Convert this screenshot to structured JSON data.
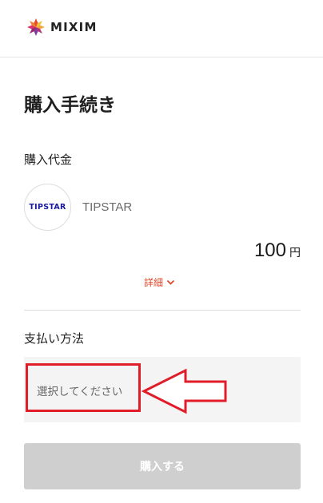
{
  "brand": {
    "name": "MIXIM",
    "logo_icon": "mixim-logo-icon",
    "logo_colors": [
      "#e84a2b",
      "#f2a93b",
      "#7b3fa0",
      "#d6336c"
    ]
  },
  "page": {
    "title": "購入手続き"
  },
  "purchase_amount": {
    "label": "購入代金",
    "product": {
      "logo_text": "TIPSTAR",
      "name": "TIPSTAR"
    },
    "price": "100",
    "currency": "円",
    "details_link": "詳細",
    "details_icon": "chevron-down-icon"
  },
  "payment": {
    "label": "支払い方法",
    "select_placeholder": "選択してください"
  },
  "annotation": {
    "highlight_color": "#e11d2a",
    "arrow_icon": "left-arrow-icon"
  },
  "actions": {
    "purchase_label": "購入する",
    "purchase_disabled": true
  },
  "colors": {
    "accent": "#e0492b",
    "disabled_button": "#cfcfcf",
    "product_logo_text": "#1a1aa0"
  }
}
